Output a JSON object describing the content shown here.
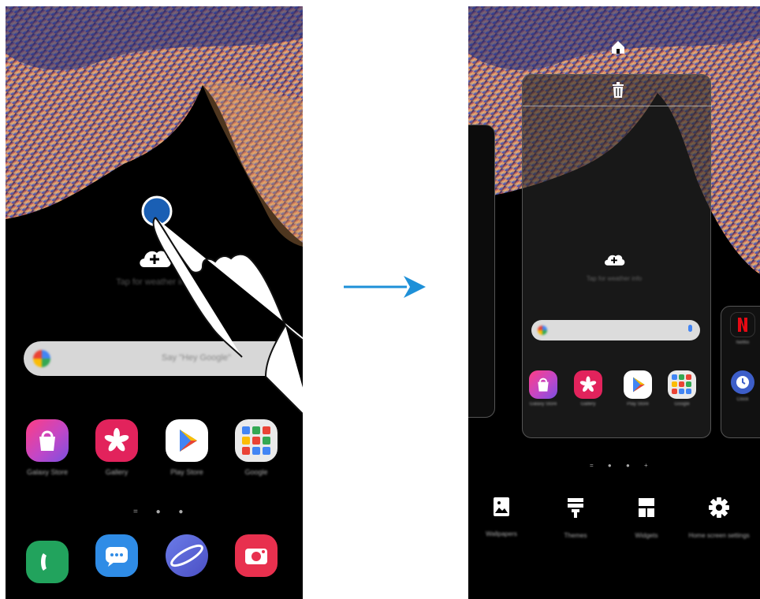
{
  "left_screen": {
    "weather_hint": "Tap for weather info",
    "search_hint": "Say \"Hey Google\"",
    "apps": [
      {
        "label": "Galaxy Store",
        "icon": "galaxy-store-icon"
      },
      {
        "label": "Gallery",
        "icon": "gallery-icon"
      },
      {
        "label": "Play Store",
        "icon": "play-store-icon"
      },
      {
        "label": "Google",
        "icon": "google-folder-icon"
      }
    ],
    "dock": [
      {
        "icon": "phone-icon"
      },
      {
        "icon": "messages-icon"
      },
      {
        "icon": "internet-icon"
      },
      {
        "icon": "camera-icon"
      }
    ],
    "page_indicator": "= ● ●"
  },
  "right_screen": {
    "weather_hint": "Tap for weather info",
    "apps": [
      {
        "label": "Galaxy Store",
        "icon": "galaxy-store-icon"
      },
      {
        "label": "Gallery",
        "icon": "gallery-icon"
      },
      {
        "label": "Play Store",
        "icon": "play-store-icon"
      },
      {
        "label": "Google",
        "icon": "google-folder-icon"
      }
    ],
    "side_apps": [
      {
        "label": "Netflix",
        "icon": "netflix-icon"
      },
      {
        "label": "Clock",
        "icon": "clock-icon"
      }
    ],
    "page_indicator": "= ● ● +",
    "settings": [
      {
        "label": "Wallpapers",
        "icon": "wallpaper-icon"
      },
      {
        "label": "Themes",
        "icon": "themes-icon"
      },
      {
        "label": "Widgets",
        "icon": "widgets-icon"
      },
      {
        "label": "Home screen settings",
        "icon": "gear-icon"
      }
    ]
  },
  "colors": {
    "arrow": "#1e90d8",
    "touch_point": "#1a5fb4"
  }
}
